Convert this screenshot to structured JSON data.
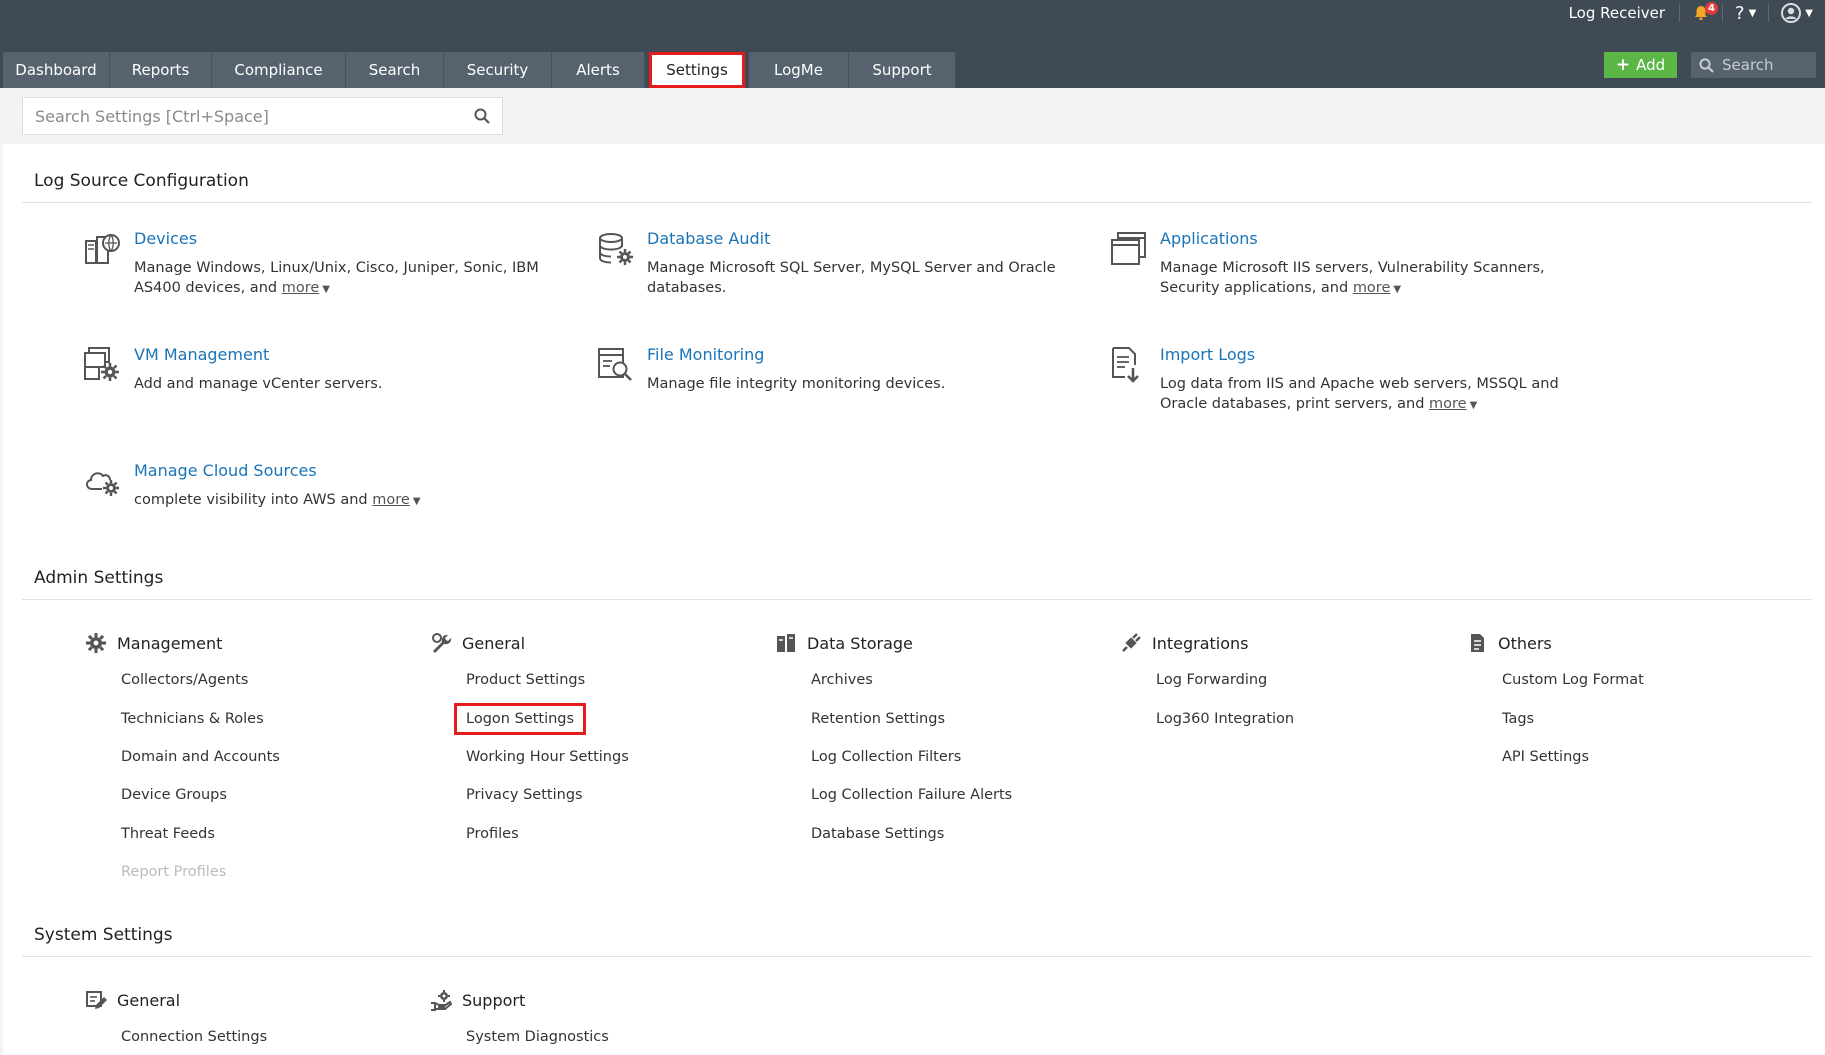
{
  "topbar": {
    "user_label": "Log Receiver",
    "bell_count": "4",
    "help_label": "?",
    "add_label": "Add",
    "search_placeholder": "Search"
  },
  "tabs": [
    {
      "label": "Dashboard"
    },
    {
      "label": "Reports"
    },
    {
      "label": "Compliance"
    },
    {
      "label": "Search"
    },
    {
      "label": "Security"
    },
    {
      "label": "Alerts"
    },
    {
      "label": "Settings"
    },
    {
      "label": "LogMe"
    },
    {
      "label": "Support"
    }
  ],
  "settings_search": {
    "placeholder": "Search Settings [Ctrl+Space]"
  },
  "log_source": {
    "title": "Log Source Configuration",
    "items": [
      {
        "title": "Devices",
        "desc": "Manage Windows, Linux/Unix, Cisco, Juniper, Sonic, IBM AS400 devices, and",
        "more": "more"
      },
      {
        "title": "Database Audit",
        "desc": "Manage Microsoft SQL Server, MySQL Server and Oracle databases.",
        "more": ""
      },
      {
        "title": "Applications",
        "desc": "Manage Microsoft IIS servers, Vulnerability Scanners, Security applications, and",
        "more": "more"
      },
      {
        "title": "VM Management",
        "desc": "Add and manage vCenter servers.",
        "more": ""
      },
      {
        "title": "File Monitoring",
        "desc": "Manage file integrity monitoring devices.",
        "more": ""
      },
      {
        "title": "Import Logs",
        "desc": "Log data from IIS and Apache web servers, MSSQL and Oracle databases, print servers, and",
        "more": "more"
      },
      {
        "title": "Manage Cloud Sources",
        "desc": "complete visibility into AWS and",
        "more": "more"
      }
    ]
  },
  "admin": {
    "title": "Admin Settings",
    "groups": [
      {
        "title": "Management",
        "links": [
          "Collectors/Agents",
          "Technicians & Roles",
          "Domain and Accounts",
          "Device Groups",
          "Threat Feeds",
          "Report Profiles"
        ]
      },
      {
        "title": "General",
        "links": [
          "Product Settings",
          "Logon Settings",
          "Working Hour Settings",
          "Privacy Settings",
          "Profiles"
        ]
      },
      {
        "title": "Data Storage",
        "links": [
          "Archives",
          "Retention Settings",
          "Log Collection Filters",
          "Log Collection Failure Alerts",
          "Database Settings"
        ]
      },
      {
        "title": "Integrations",
        "links": [
          "Log Forwarding",
          "Log360 Integration"
        ]
      },
      {
        "title": "Others",
        "links": [
          "Custom Log Format",
          "Tags",
          "API Settings"
        ]
      }
    ]
  },
  "system": {
    "title": "System Settings",
    "groups": [
      {
        "title": "General",
        "links": [
          "Connection Settings"
        ]
      },
      {
        "title": "Support",
        "links": [
          "System Diagnostics"
        ]
      }
    ]
  },
  "colors": {
    "topbar": "#3f4a54",
    "tab": "#56626d",
    "link_blue": "#1a74b8",
    "add_green": "#5cb646",
    "highlight_red": "#e41b1b"
  }
}
